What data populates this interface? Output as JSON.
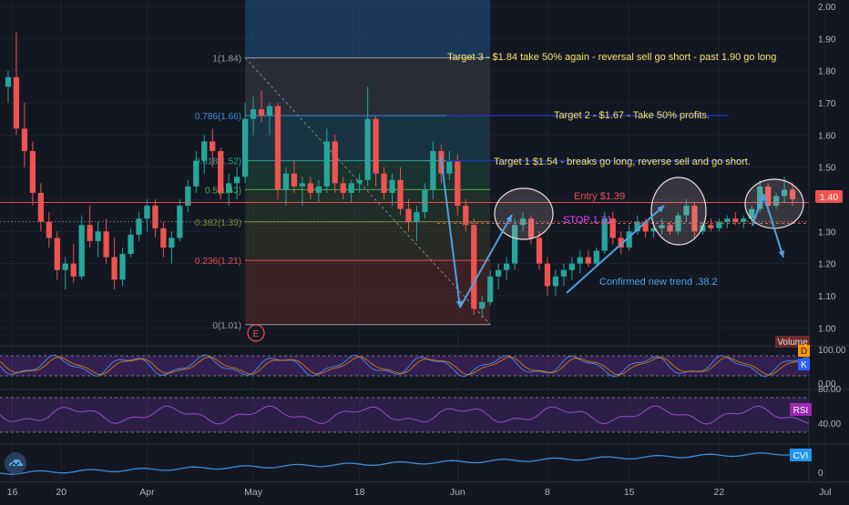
{
  "colors": {
    "background": "#131722",
    "grid": "#1e2230",
    "up": "#26a69a",
    "down": "#ef5350",
    "axis_text": "#b2b5be",
    "annotation_yellow": "#f5e66b",
    "annotation_blue": "#4fa3e0",
    "entry_red": "#e45050",
    "stop_magenta": "#e040fb",
    "oscillator_purple": "#5a2d8c",
    "cvi_line": "#3d8fd6",
    "price_tag": "#ef5350"
  },
  "chart_data": [
    {
      "type": "candlestick",
      "panel": "price",
      "ylim": [
        0.95,
        2.02
      ],
      "y_ticks": [
        "2.00",
        "1.90",
        "1.80",
        "1.70",
        "1.60",
        "1.50",
        "1.40",
        "1.30",
        "1.20",
        "1.10",
        "1.00"
      ],
      "y_tick_values": [
        2.0,
        1.9,
        1.8,
        1.7,
        1.6,
        1.5,
        1.4,
        1.3,
        1.2,
        1.1,
        1.0
      ],
      "x_ticks": [
        "16",
        "20",
        "Apr",
        "May",
        "18",
        "Jun",
        "8",
        "15",
        "22",
        "Jul"
      ],
      "x_tick_positions": [
        0.5,
        6.5,
        17,
        30,
        43,
        55,
        66,
        76,
        87,
        100
      ],
      "last_price_label": "1.40",
      "last_price": 1.4,
      "fibonacci": {
        "levels": [
          {
            "label": "1(1.84)",
            "value": 1.84,
            "color": "#9e9e9e"
          },
          {
            "label": "0.786(1.66)",
            "value": 1.66,
            "color": "#3a8fd8"
          },
          {
            "label": "0.618(1.52)",
            "value": 1.52,
            "color": "#26a69a"
          },
          {
            "label": "0.5(1.43)",
            "value": 1.43,
            "color": "#4caf50"
          },
          {
            "label": "0.382(1.33)",
            "value": 1.33,
            "color": "#7f8c2d"
          },
          {
            "label": "0.236(1.21)",
            "value": 1.21,
            "color": "#e45050"
          },
          {
            "label": "0(1.01)",
            "value": 1.01,
            "color": "#9e9e9e"
          }
        ],
        "x_start": 29,
        "x_end": 59
      },
      "annotations": {
        "target3": "Target 3 - $1.84 take 50% again - reversal sell go short - past 1.90 go long",
        "target2": "Target 2 - $1.67 - Take 50% profits.",
        "target1": "Target 1  $1.54 - breaks go long, reverse sell and go short.",
        "entry": "Entry $1.39",
        "stop": "STOP 1.31",
        "trend": "Confirmed new trend .38.2",
        "earnings_marker": "E"
      },
      "candles": [
        [
          1.75,
          1.8,
          1.7,
          1.78
        ],
        [
          1.78,
          1.92,
          1.6,
          1.62
        ],
        [
          1.62,
          1.7,
          1.5,
          1.55
        ],
        [
          1.55,
          1.58,
          1.38,
          1.42
        ],
        [
          1.42,
          1.45,
          1.3,
          1.33
        ],
        [
          1.33,
          1.36,
          1.25,
          1.28
        ],
        [
          1.28,
          1.3,
          1.15,
          1.18
        ],
        [
          1.18,
          1.22,
          1.12,
          1.2
        ],
        [
          1.2,
          1.26,
          1.14,
          1.16
        ],
        [
          1.16,
          1.35,
          1.15,
          1.32
        ],
        [
          1.32,
          1.38,
          1.25,
          1.27
        ],
        [
          1.27,
          1.33,
          1.22,
          1.3
        ],
        [
          1.3,
          1.34,
          1.2,
          1.22
        ],
        [
          1.22,
          1.28,
          1.12,
          1.15
        ],
        [
          1.15,
          1.25,
          1.13,
          1.23
        ],
        [
          1.23,
          1.31,
          1.22,
          1.29
        ],
        [
          1.29,
          1.36,
          1.27,
          1.34
        ],
        [
          1.34,
          1.4,
          1.3,
          1.38
        ],
        [
          1.38,
          1.4,
          1.28,
          1.31
        ],
        [
          1.31,
          1.33,
          1.22,
          1.25
        ],
        [
          1.25,
          1.3,
          1.2,
          1.28
        ],
        [
          1.28,
          1.4,
          1.27,
          1.38
        ],
        [
          1.38,
          1.46,
          1.36,
          1.44
        ],
        [
          1.44,
          1.55,
          1.42,
          1.52
        ],
        [
          1.52,
          1.6,
          1.48,
          1.58
        ],
        [
          1.58,
          1.62,
          1.5,
          1.55
        ],
        [
          1.55,
          1.56,
          1.4,
          1.42
        ],
        [
          1.42,
          1.48,
          1.38,
          1.45
        ],
        [
          1.45,
          1.5,
          1.4,
          1.47
        ],
        [
          1.47,
          1.7,
          1.45,
          1.65
        ],
        [
          1.65,
          1.72,
          1.6,
          1.68
        ],
        [
          1.68,
          1.74,
          1.64,
          1.66
        ],
        [
          1.66,
          1.7,
          1.6,
          1.69
        ],
        [
          1.69,
          1.7,
          1.4,
          1.43
        ],
        [
          1.43,
          1.5,
          1.38,
          1.48
        ],
        [
          1.48,
          1.52,
          1.42,
          1.44
        ],
        [
          1.44,
          1.47,
          1.38,
          1.45
        ],
        [
          1.45,
          1.47,
          1.4,
          1.42
        ],
        [
          1.42,
          1.46,
          1.39,
          1.44
        ],
        [
          1.44,
          1.62,
          1.42,
          1.58
        ],
        [
          1.58,
          1.6,
          1.42,
          1.45
        ],
        [
          1.45,
          1.47,
          1.4,
          1.42
        ],
        [
          1.42,
          1.46,
          1.39,
          1.45
        ],
        [
          1.45,
          1.48,
          1.42,
          1.46
        ],
        [
          1.46,
          1.75,
          1.44,
          1.65
        ],
        [
          1.65,
          1.66,
          1.44,
          1.48
        ],
        [
          1.48,
          1.5,
          1.4,
          1.42
        ],
        [
          1.42,
          1.48,
          1.38,
          1.46
        ],
        [
          1.46,
          1.5,
          1.35,
          1.37
        ],
        [
          1.37,
          1.4,
          1.3,
          1.33
        ],
        [
          1.33,
          1.38,
          1.27,
          1.36
        ],
        [
          1.36,
          1.45,
          1.34,
          1.43
        ],
        [
          1.43,
          1.58,
          1.4,
          1.55
        ],
        [
          1.55,
          1.57,
          1.45,
          1.48
        ],
        [
          1.48,
          1.55,
          1.46,
          1.52
        ],
        [
          1.52,
          1.54,
          1.35,
          1.38
        ],
        [
          1.38,
          1.4,
          1.3,
          1.32
        ],
        [
          1.32,
          1.34,
          1.04,
          1.06
        ],
        [
          1.06,
          1.1,
          1.03,
          1.08
        ],
        [
          1.08,
          1.18,
          1.07,
          1.16
        ],
        [
          1.16,
          1.2,
          1.12,
          1.18
        ],
        [
          1.18,
          1.22,
          1.15,
          1.2
        ],
        [
          1.2,
          1.34,
          1.18,
          1.32
        ],
        [
          1.32,
          1.36,
          1.3,
          1.34
        ],
        [
          1.34,
          1.35,
          1.26,
          1.28
        ],
        [
          1.28,
          1.3,
          1.18,
          1.2
        ],
        [
          1.2,
          1.22,
          1.1,
          1.13
        ],
        [
          1.13,
          1.18,
          1.1,
          1.16
        ],
        [
          1.16,
          1.2,
          1.13,
          1.18
        ],
        [
          1.18,
          1.22,
          1.15,
          1.2
        ],
        [
          1.2,
          1.24,
          1.17,
          1.22
        ],
        [
          1.22,
          1.24,
          1.19,
          1.2
        ],
        [
          1.2,
          1.25,
          1.19,
          1.24
        ],
        [
          1.24,
          1.36,
          1.23,
          1.34
        ],
        [
          1.34,
          1.36,
          1.26,
          1.28
        ],
        [
          1.28,
          1.3,
          1.23,
          1.25
        ],
        [
          1.25,
          1.32,
          1.24,
          1.3
        ],
        [
          1.3,
          1.35,
          1.29,
          1.33
        ],
        [
          1.33,
          1.34,
          1.28,
          1.3
        ],
        [
          1.3,
          1.33,
          1.28,
          1.31
        ],
        [
          1.31,
          1.34,
          1.29,
          1.32
        ],
        [
          1.32,
          1.33,
          1.29,
          1.3
        ],
        [
          1.3,
          1.36,
          1.29,
          1.35
        ],
        [
          1.35,
          1.4,
          1.33,
          1.38
        ],
        [
          1.38,
          1.39,
          1.28,
          1.3
        ],
        [
          1.3,
          1.33,
          1.29,
          1.32
        ],
        [
          1.32,
          1.34,
          1.3,
          1.31
        ],
        [
          1.31,
          1.34,
          1.3,
          1.33
        ],
        [
          1.33,
          1.35,
          1.31,
          1.34
        ],
        [
          1.34,
          1.36,
          1.32,
          1.33
        ],
        [
          1.33,
          1.35,
          1.31,
          1.34
        ],
        [
          1.34,
          1.38,
          1.33,
          1.37
        ],
        [
          1.37,
          1.46,
          1.36,
          1.44
        ],
        [
          1.44,
          1.45,
          1.36,
          1.38
        ],
        [
          1.38,
          1.42,
          1.37,
          1.41
        ],
        [
          1.41,
          1.47,
          1.39,
          1.43
        ],
        [
          1.43,
          1.45,
          1.38,
          1.4
        ]
      ]
    },
    {
      "type": "line",
      "panel": "stochastic",
      "name_labels": [
        "D",
        "K"
      ],
      "y_ticks": [
        "100.00",
        "0.00"
      ],
      "ylim": [
        0,
        100
      ],
      "band": [
        20,
        80
      ],
      "series": [
        {
          "name": "K",
          "color": "#4e7fd9"
        },
        {
          "name": "D",
          "color": "#ff9800"
        }
      ]
    },
    {
      "type": "line",
      "panel": "rsi",
      "name_label": "RSI",
      "y_ticks": [
        "80.00",
        "40.00"
      ],
      "ylim": [
        30,
        85
      ]
    },
    {
      "type": "line",
      "panel": "cvi",
      "name_label": "CVI",
      "y_ticks": [
        "0"
      ]
    }
  ],
  "volume_label": "Volume",
  "watermark_icon": "tradingview-cloud-icon"
}
